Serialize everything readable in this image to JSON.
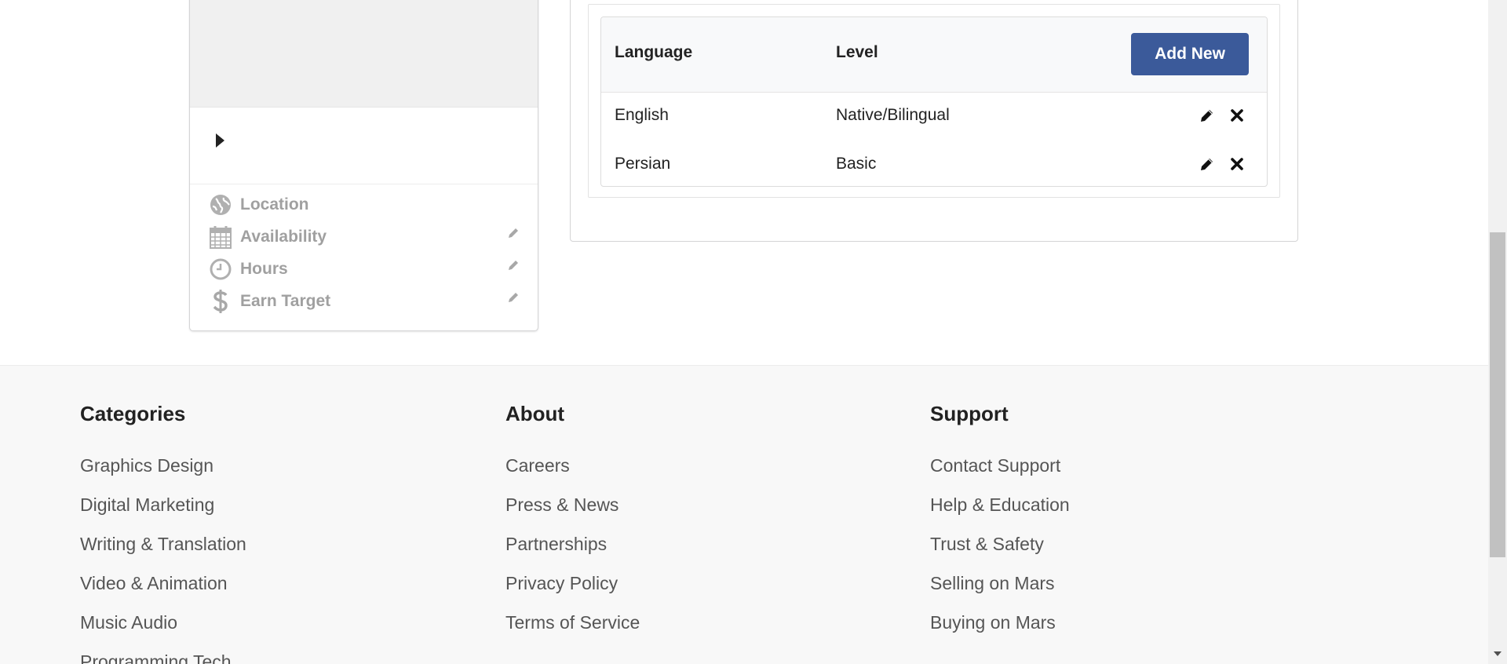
{
  "profile": {
    "items": [
      {
        "icon": "globe-icon",
        "label": "Location",
        "editable": false
      },
      {
        "icon": "calendar-icon",
        "label": "Availability",
        "editable": true
      },
      {
        "icon": "clock-icon",
        "label": "Hours",
        "editable": true
      },
      {
        "icon": "dollar-icon",
        "label": "Earn Target",
        "editable": true
      }
    ]
  },
  "languages": {
    "headers": {
      "language": "Language",
      "level": "Level"
    },
    "add_label": "Add New",
    "rows": [
      {
        "language": "English",
        "level": "Native/Bilingual"
      },
      {
        "language": "Persian",
        "level": "Basic"
      }
    ]
  },
  "footer": {
    "categories": {
      "title": "Categories",
      "links": [
        "Graphics Design",
        "Digital Marketing",
        "Writing & Translation",
        "Video & Animation",
        "Music Audio",
        "Programming Tech"
      ]
    },
    "about": {
      "title": "About",
      "links": [
        "Careers",
        "Press & News",
        "Partnerships",
        "Privacy Policy",
        "Terms of Service"
      ]
    },
    "support": {
      "title": "Support",
      "links": [
        "Contact Support",
        "Help & Education",
        "Trust & Safety",
        "Selling on Mars",
        "Buying on Mars"
      ]
    }
  },
  "colors": {
    "accent": "#3b5a9a",
    "footer_bg": "#f8f8f8",
    "muted_text": "#a0a0a0"
  }
}
